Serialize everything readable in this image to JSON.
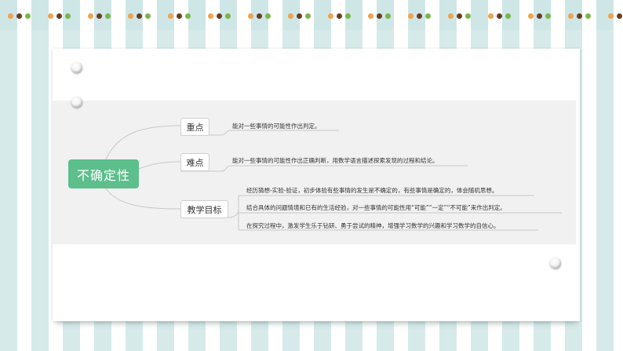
{
  "decor": {
    "dot_colors": [
      "#f0a24e",
      "#6a3d2a",
      "#7ab648"
    ]
  },
  "mindmap": {
    "central": "不确定性",
    "branches": [
      {
        "label": "重点",
        "items": [
          "能对一些事情的可能性作出判定。"
        ]
      },
      {
        "label": "难点",
        "items": [
          "能对一些事情的可能性作出正确判断，用数学语言描述探索发现的过程和结论。"
        ]
      },
      {
        "label": "教学目标",
        "items": [
          "经历猜想-实验-验证，初步体验有些事情的发生是不确定的，有些事情是确定的，体会随机思想。",
          "结合具体的问题情境和已有的生活经验，对一些事情的可能性用“可能”“一定”“不可能”来作出判定。",
          "在探究过程中，激发学生乐于钻研、勇于尝试的精神，增强学习数学的兴趣和学习数学的自信心。"
        ]
      }
    ],
    "colors": {
      "central_fill": "#5cbf8c",
      "line": "#c8c8c8",
      "panel": "#f1f1f1"
    }
  }
}
